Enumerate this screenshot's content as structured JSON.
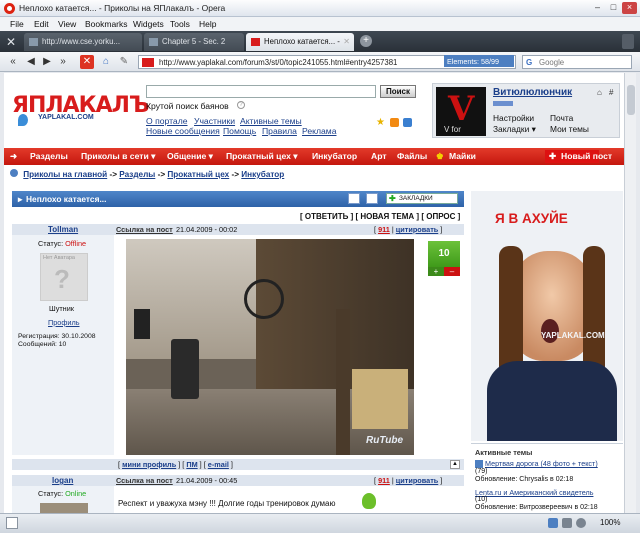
{
  "window": {
    "title": "Неплохо катается... - Приколы на ЯПлакалъ - Opera",
    "controls": [
      "–",
      "□",
      "×"
    ]
  },
  "menu": [
    "File",
    "Edit",
    "View",
    "Bookmarks",
    "Widgets",
    "Tools",
    "Help"
  ],
  "tabs": [
    {
      "label": "http://www.cse.yorku..."
    },
    {
      "label": "Chapter 5 - Sec. 2"
    },
    {
      "label": "Неплохо катается... -"
    }
  ],
  "address": {
    "url": "http://www.yaplakal.com/forum3/st/0/topic241055.html#entry4257381",
    "elements_badge": "Elements: 58/99",
    "search_placeholder": "Google"
  },
  "site": {
    "logo": "ЯПЛАКАЛЪ",
    "logo_sub": "YAPLAKAL.COM",
    "search_button": "Поиск",
    "tagline": "Крутой поиск баянов",
    "links_row1": [
      "О портале",
      "Участники",
      "Активные темы"
    ],
    "links_row2": [
      "Новые сообщения",
      "Помощь",
      "Правила",
      "Реклама"
    ],
    "username": "Витюлюлюнчик",
    "user_links": [
      "Настройки",
      "Почта",
      "Закладки ▾",
      "Мои темы"
    ],
    "avatar_text": "V for"
  },
  "nav": {
    "items": [
      "Разделы",
      "Приколы в сети ▾",
      "Общение ▾",
      "Прокатный цех ▾",
      "Инкубатор",
      "Арт",
      "Файлы",
      "Майки"
    ],
    "new_post": "Новый пост"
  },
  "breadcrumb": [
    "Приколы на главной",
    "Разделы",
    "Прокатный цех",
    "Инкубатор"
  ],
  "topic": {
    "title": "Неплохо катается...",
    "bookmarks_label": "ЗАКЛАДКИ",
    "actions": [
      "[ ОТВЕТИТЬ ]",
      "[ НОВАЯ ТЕМА ]",
      "[ ОПРОС ]"
    ]
  },
  "post1": {
    "author": "Tollman",
    "status_label": "Статус:",
    "status": "Offline",
    "avatar_placeholder": "Нет Аватара",
    "rank": "Шутник",
    "profile": "Профиль",
    "registered": "Регистрация: 30.10.2008",
    "messages": "Сообщений: 10",
    "link_label": "Ссылка на пост",
    "date": "21.04.2009 - 00:02",
    "number": "911",
    "quote": "цитировать",
    "rating": "10",
    "video_watermark": "RuTube",
    "footer_links": [
      "мини профиль",
      "ПМ",
      "e-mail"
    ]
  },
  "post2": {
    "author": "logan",
    "status_label": "Статус:",
    "status": "Online",
    "link_label": "Ссылка на пост",
    "date": "21.04.2009 - 00:45",
    "number": "911",
    "quote": "цитировать",
    "text": "Респект и уважуха мэну !!! Долгие годы тренировок думаю"
  },
  "ad": {
    "title": "Я В АХУЙЕ",
    "watermark": "YAPLAKAL.COM"
  },
  "active_topics": {
    "header": "Активные темы",
    "item1": "Мертвая дорога (48 фото + текст)",
    "item1_count": "(79)",
    "item1_update": "Обновление: Chrysalis в 02:18",
    "item2": "Lenta.ru и Американский свидетель",
    "item2_count": "(10)",
    "item2_update": "Обновление: Витрозвереевич в 02:18"
  },
  "statusbar": {
    "zoom": "100%"
  }
}
